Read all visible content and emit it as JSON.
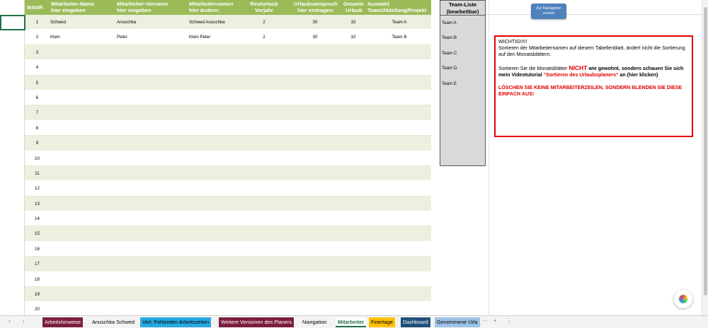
{
  "columns": {
    "manr": "MANR",
    "name": [
      "Mitarbeiter-Name",
      "hier eingeben"
    ],
    "vorname": [
      "Mitarbeiter-Vorname",
      "hier eingeben"
    ],
    "fullname": [
      "Mitarbeiternamen",
      "hier ändern:"
    ],
    "rest": [
      "Resturlaub",
      "Vorjahr"
    ],
    "anspruch": [
      "Urlaubsanspruch",
      "hier eintragen:"
    ],
    "gesamt": [
      "Gesamt-",
      "Urlaub"
    ],
    "team": [
      "Auswahl",
      "Team/Abteilung/Projekt"
    ]
  },
  "rows": [
    {
      "manr": "1",
      "name": "Schwed",
      "vorname": "Anuschka",
      "fullname": "Schwed Anuschka",
      "rest": "2",
      "anspruch": "30",
      "gesamt": "32",
      "team": "Team A"
    },
    {
      "manr": "2",
      "name": "Klein",
      "vorname": "Peter",
      "fullname": "Klein Peter",
      "rest": "2",
      "anspruch": "30",
      "gesamt": "32",
      "team": "Team B"
    },
    {
      "manr": "3"
    },
    {
      "manr": "4"
    },
    {
      "manr": "5"
    },
    {
      "manr": "6"
    },
    {
      "manr": "7"
    },
    {
      "manr": "8"
    },
    {
      "manr": "9"
    },
    {
      "manr": "10"
    },
    {
      "manr": "11"
    },
    {
      "manr": "12"
    },
    {
      "manr": "13"
    },
    {
      "manr": "14"
    },
    {
      "manr": "15"
    },
    {
      "manr": "16"
    },
    {
      "manr": "17"
    },
    {
      "manr": "18"
    },
    {
      "manr": "19"
    },
    {
      "manr": "20"
    }
  ],
  "team_list": {
    "title": [
      "Team-Liste",
      "(bearbeitbar)"
    ],
    "items": [
      "Team A",
      "Team B",
      "Team C",
      "Team D",
      "Team E"
    ]
  },
  "nav_button": [
    "Zur Navigation",
    "zurück"
  ],
  "warning": {
    "title": "WICHTIG!!!!!",
    "p1": "Sortieren der Mitarbeiternamen auf diesem Tabellenblatt, ändert nicht die Sortierung auf den Monatsblättern.",
    "p2_a": "Sortieren Sie die Monatsblätter ",
    "p2_nicht": "NICHT",
    "p2_b": " wie gewohnt, sondern schauen Sie sich mein Videotutorial ",
    "p2_link": "\"Sortieren des Urlaubsplaners\"",
    "p2_c": " an (hier klicken)",
    "p3": "LÖSCHEN SIE KEINE MITARBEITERZEILEN, SONDERN BLENDEN SIE DIESE EINFACH AUS!"
  },
  "tabs": [
    {
      "label": "Arbeitshinweise",
      "bg": "#7b1c3f",
      "fg": "#ffffff"
    },
    {
      "label": "Anuschka Schwed",
      "bg": "",
      "fg": "#000000"
    },
    {
      "label": "Vorl. Fehlzeiten  Arbeitszeiten",
      "bg": "#27a9e1",
      "fg": "#000000"
    },
    {
      "label": "Weitere Versionen des Planers",
      "bg": "#7b1c3f",
      "fg": "#ffffff"
    },
    {
      "label": "Navigation",
      "bg": "",
      "fg": "#000000"
    },
    {
      "label": "Mitarbeiter",
      "bg": "",
      "fg": "#217346"
    },
    {
      "label": "Feiertage",
      "bg": "#ffc000",
      "fg": "#000000"
    },
    {
      "label": "Dashboard",
      "bg": "#1f4e79",
      "fg": "#ffffff"
    },
    {
      "label": "Genommene Urla",
      "bg": "#9dc3e6",
      "fg": "#000000"
    }
  ],
  "tabbar_controls": {
    "prev": "‹",
    "next": "›",
    "more": "···",
    "add": "+",
    "options": "⋮"
  },
  "colors": {
    "header_green": "#9bbb59",
    "band": "#ebf1de",
    "warning_red": "#e00000"
  }
}
